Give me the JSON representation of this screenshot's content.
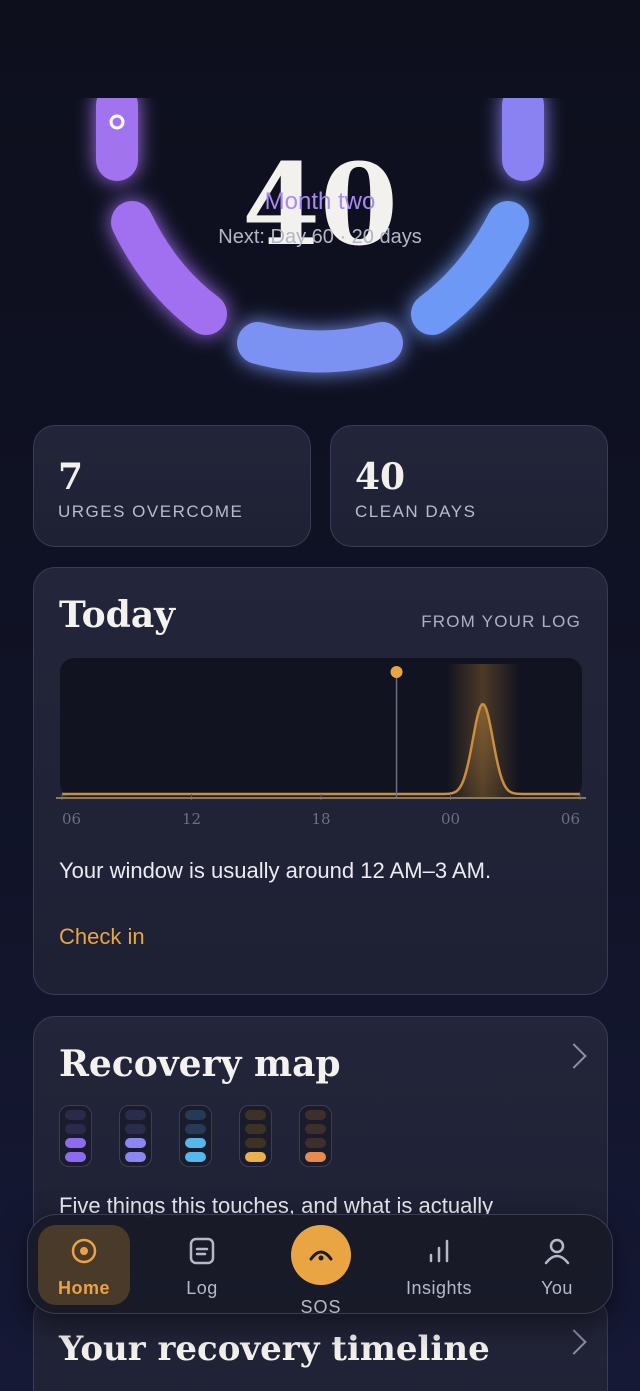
{
  "hero": {
    "day_count": "40",
    "phase": "Month two",
    "next": "Next: Day 60 · 20 days"
  },
  "stats": [
    {
      "value": "7",
      "label": "URGES OVERCOME"
    },
    {
      "value": "40",
      "label": "CLEAN DAYS"
    }
  ],
  "today": {
    "title": "Today",
    "source": "FROM YOUR LOG",
    "window_text": "Your window is usually around 12 AM–3 AM.",
    "check_in": "Check in",
    "chart_data": {
      "type": "area",
      "x_ticks": [
        "06",
        "12",
        "18",
        "00",
        "06"
      ],
      "now_marker_hour": 21.5,
      "risk_peak_hour": 1.5,
      "highlight_window": [
        "00",
        "03"
      ]
    }
  },
  "recovery_map": {
    "title": "Recovery map",
    "description": "Five things this touches, and what is actually",
    "pillars": [
      {
        "colors": [
          "#2c2a48",
          "#2c2a48",
          "#8b6cf0",
          "#8b6cf0"
        ]
      },
      {
        "colors": [
          "#2a2c4c",
          "#2a2c4c",
          "#8a86f2",
          "#8a86f2"
        ]
      },
      {
        "colors": [
          "#243a55",
          "#243a55",
          "#56b7ea",
          "#56b7ea"
        ]
      },
      {
        "colors": [
          "#3c3226",
          "#3c3226",
          "#3c3226",
          "#e9b04c"
        ]
      },
      {
        "colors": [
          "#3e2e2c",
          "#3e2e2c",
          "#3e2e2c",
          "#e58b50"
        ]
      }
    ]
  },
  "timeline": {
    "title": "Your recovery timeline"
  },
  "tabs": {
    "home": "Home",
    "log": "Log",
    "sos": "SOS",
    "insights": "Insights",
    "you": "You"
  },
  "colors": {
    "accent": "#e9a544",
    "ring_start": "#a270f2",
    "ring_end": "#6f93f4",
    "phase": "#a98af7"
  }
}
